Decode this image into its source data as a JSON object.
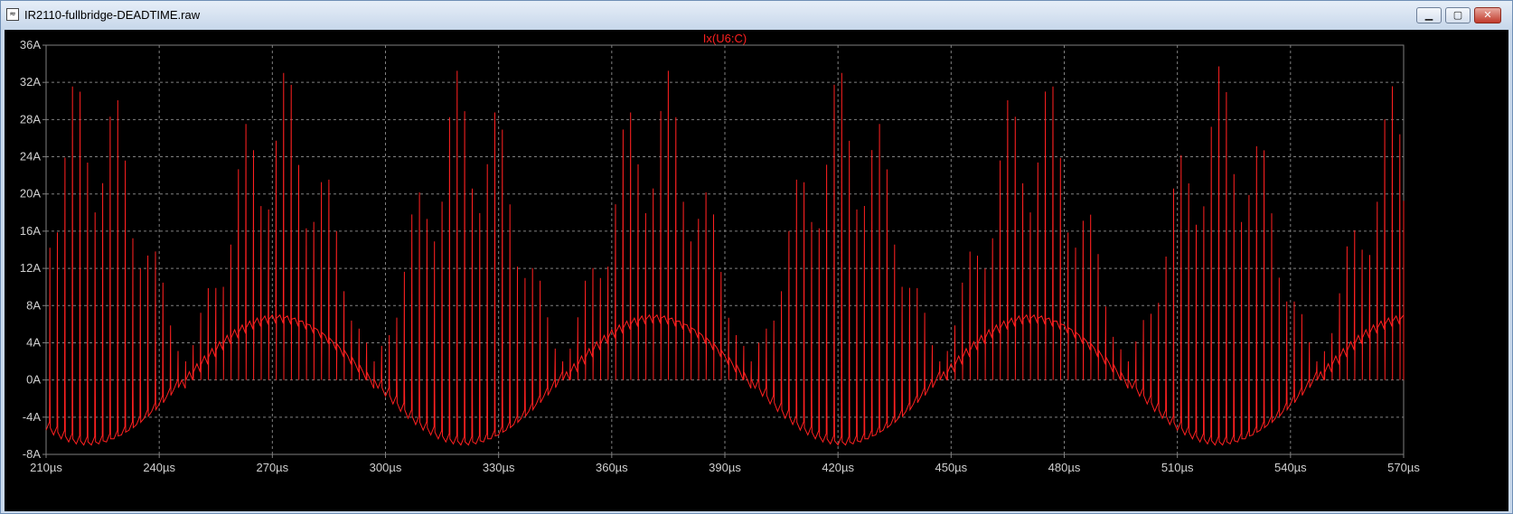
{
  "window": {
    "title": "IR2110-fullbridge-DEADTIME.raw",
    "icon": "waveform-file-icon",
    "controls": {
      "minimize": "▁",
      "maximize": "▢",
      "close": "✕"
    }
  },
  "chart_data": {
    "type": "line",
    "series": [
      {
        "name": "Ix(U6:C)",
        "color": "#ff2020"
      }
    ],
    "xlim": [
      210,
      570
    ],
    "ylim": [
      -8,
      36
    ],
    "x_unit": "µs",
    "y_unit": "A",
    "xticks": [
      "210µs",
      "240µs",
      "270µs",
      "300µs",
      "330µs",
      "360µs",
      "390µs",
      "420µs",
      "450µs",
      "480µs",
      "510µs",
      "540µs",
      "570µs"
    ],
    "yticks": [
      "36A",
      "32A",
      "28A",
      "24A",
      "20A",
      "16A",
      "12A",
      "8A",
      "4A",
      "0A",
      "-4A",
      "-8A"
    ],
    "grid": true,
    "background": "#000000",
    "sine_envelope_period_us": 100,
    "sine_envelope_peak_A": 7,
    "spike_peak_A": 34,
    "pwm_switching_period_us": 2
  }
}
